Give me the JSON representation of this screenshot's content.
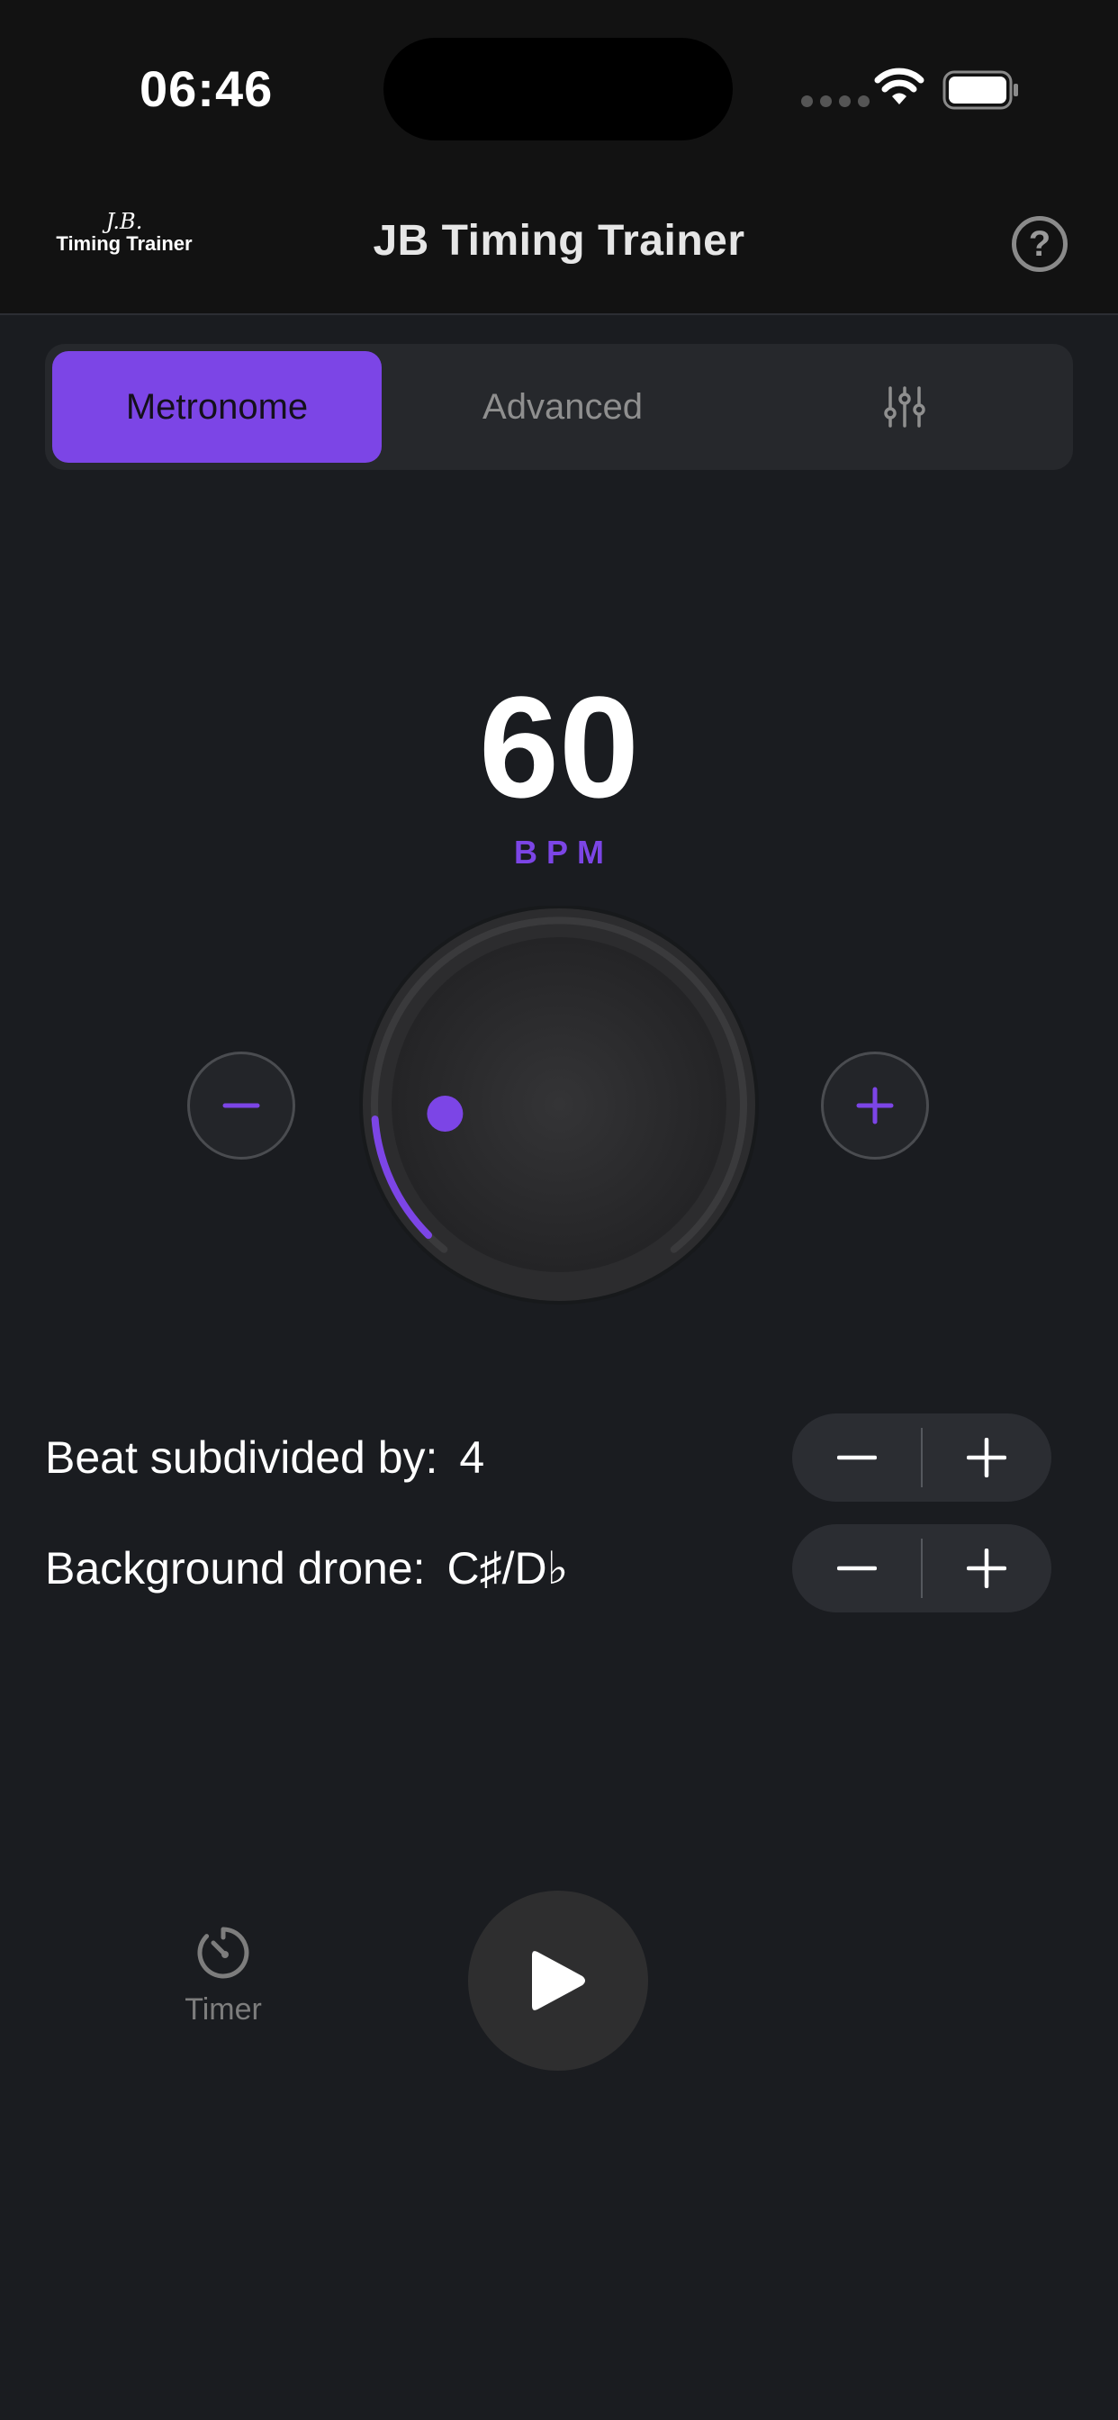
{
  "status_bar": {
    "time": "06:46"
  },
  "header": {
    "logo_script": "J.B.",
    "logo_text": "Timing Trainer",
    "title": "JB Timing Trainer",
    "help_label": "?"
  },
  "tabs": [
    {
      "label": "Metronome",
      "active": true
    },
    {
      "label": "Advanced",
      "active": false
    },
    {
      "icon": "sliders-icon",
      "active": false
    }
  ],
  "tempo": {
    "bpm": "60",
    "unit_label": "BPM",
    "knob_fraction": 0.15
  },
  "settings": {
    "beat_subdivision": {
      "label": "Beat subdivided by:",
      "value": "4"
    },
    "background_drone": {
      "label": "Background drone:",
      "value": "C♯/D♭"
    }
  },
  "bottom": {
    "timer_label": "Timer",
    "timer_icon": "timer-icon",
    "play_icon": "play-icon"
  },
  "colors": {
    "accent": "#7c45e6",
    "background": "#1a1c20",
    "header_background": "#121212"
  }
}
